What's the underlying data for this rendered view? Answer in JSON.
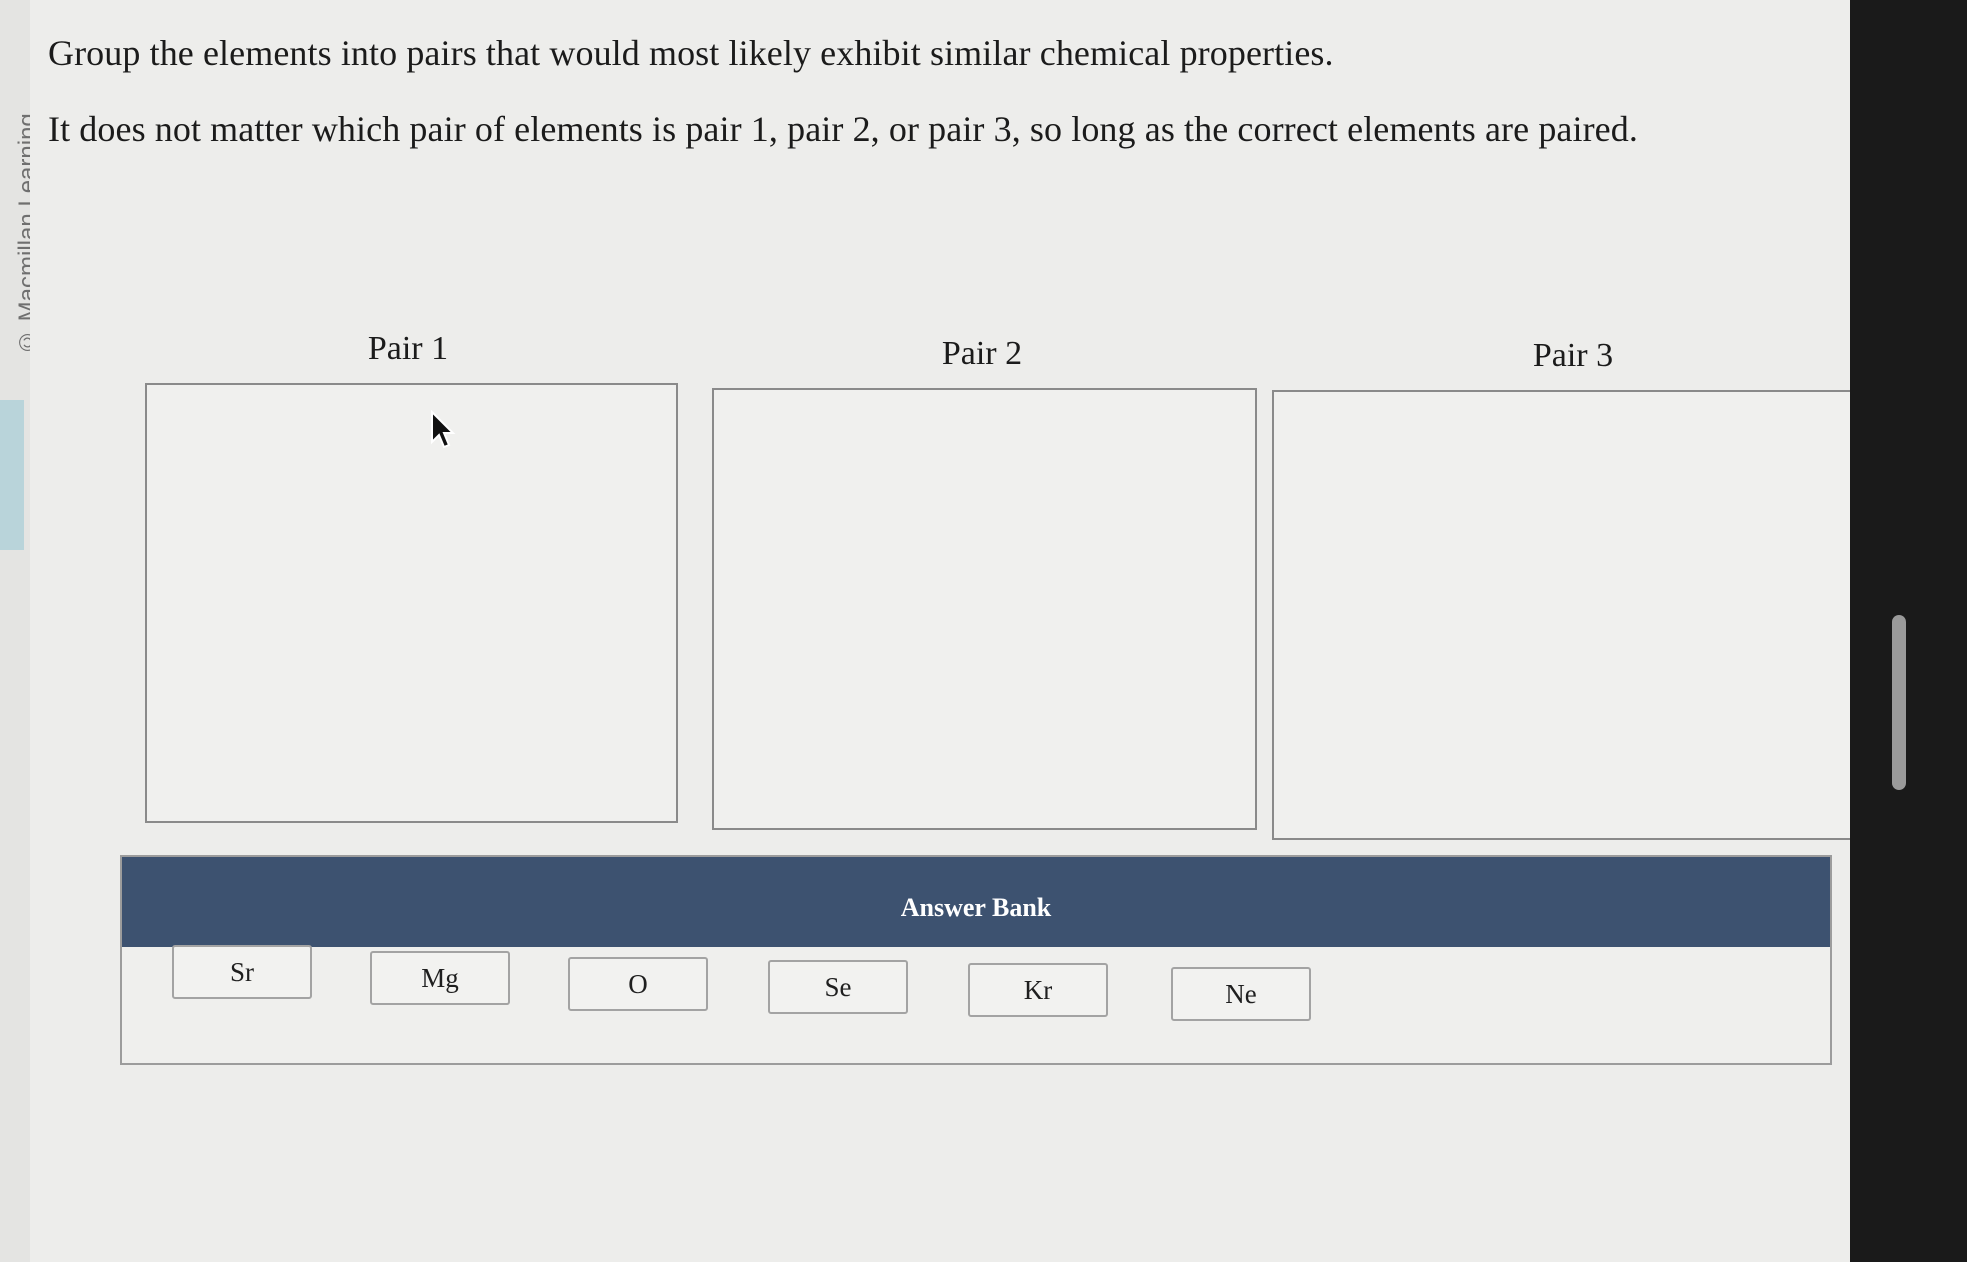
{
  "credit": "© Macmillan Learning",
  "instructions": {
    "line1": "Group the elements into pairs that would most likely exhibit similar chemical properties.",
    "line2": "It does not matter which pair of elements is pair 1, pair 2, or pair 3, so long as the correct elements are paired."
  },
  "pairs": [
    {
      "label": "Pair 1"
    },
    {
      "label": "Pair 2"
    },
    {
      "label": "Pair 3"
    }
  ],
  "answer_bank": {
    "title": "Answer Bank",
    "items": [
      "Sr",
      "Mg",
      "O",
      "Se",
      "Kr",
      "Ne"
    ]
  },
  "colors": {
    "header": "#3d5270",
    "background": "#ededeb"
  }
}
